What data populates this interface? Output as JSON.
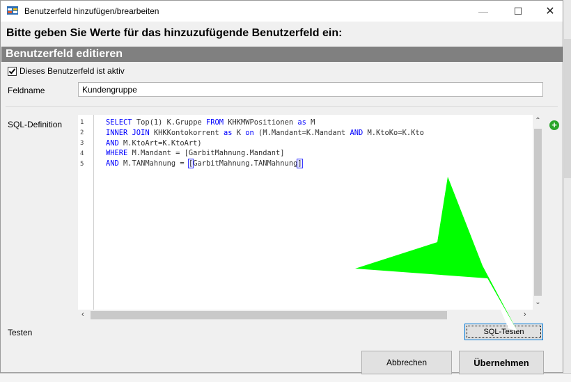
{
  "window": {
    "title": "Benutzerfeld hinzufügen/brearbeiten"
  },
  "heading": "Bitte geben Sie Werte für das hinzuzufügende Benutzerfeld ein:",
  "section": {
    "title": "Benutzerfeld editieren"
  },
  "active_checkbox": {
    "label": "Dieses Benutzerfeld ist aktiv",
    "checked": true
  },
  "fieldname": {
    "label": "Feldname",
    "value": "Kundengruppe"
  },
  "sql": {
    "label": "SQL-Definition",
    "line_numbers": [
      "1",
      "2",
      "3",
      "4",
      "5"
    ],
    "lines": [
      "SELECT Top(1) K.Gruppe FROM KHKMWPositionen as M",
      "INNER JOIN KHKKontokorrent as K on (M.Mandant=K.Mandant AND M.KtoKo=K.Kto",
      "AND M.KtoArt=K.KtoArt)",
      "WHERE M.Mandant = [GarbitMahnung.Mandant]",
      "AND M.TANMahnung = [GarbitMahnung.TANMahnung]"
    ]
  },
  "test": {
    "label": "Testen",
    "button": "SQL-Testen"
  },
  "buttons": {
    "cancel": "Abbrechen",
    "apply": "Übernehmen"
  },
  "colors": {
    "section_bar": "#808080",
    "keyword": "#0000ff",
    "arrow": "#00ff00",
    "add_icon": "#2aa52a"
  }
}
